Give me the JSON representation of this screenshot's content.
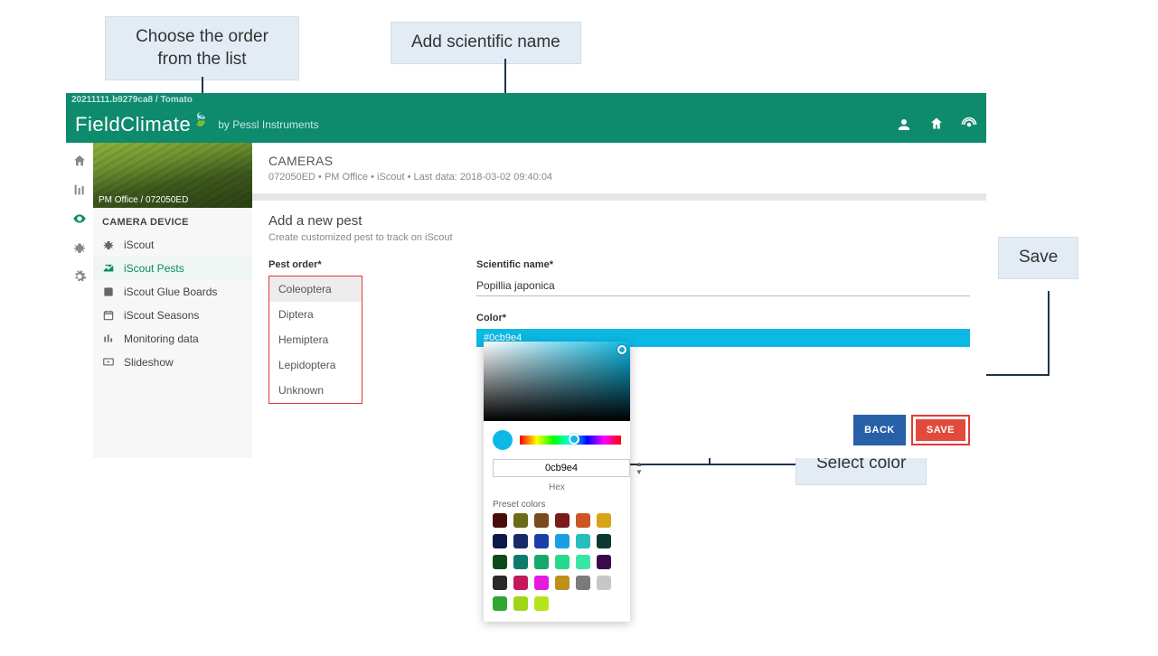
{
  "callouts": {
    "order": "Choose the order\nfrom the list",
    "sciname": "Add scientific name",
    "selcolor": "Select color",
    "save": "Save"
  },
  "breadcrumb": "20211111.b9279ca8 / Tomato",
  "logo_main": "FieldClimate",
  "logo_sub": "by Pessl Instruments",
  "sidebar": {
    "img_caption": "PM Office / 072050ED",
    "heading": "CAMERA DEVICE",
    "items": [
      {
        "label": "iScout"
      },
      {
        "label": "iScout Pests"
      },
      {
        "label": "iScout Glue Boards"
      },
      {
        "label": "iScout Seasons"
      },
      {
        "label": "Monitoring data"
      },
      {
        "label": "Slideshow"
      }
    ]
  },
  "panel": {
    "title": "CAMERAS",
    "sub": "072050ED • PM Office • iScout • Last data: 2018-03-02 09:40:04"
  },
  "form": {
    "title": "Add a new pest",
    "desc": "Create customized pest to track on iScout",
    "order_label": "Pest order*",
    "order_options": [
      "Coleoptera",
      "Diptera",
      "Hemiptera",
      "Lepidoptera",
      "Unknown"
    ],
    "sci_label": "Scientific name*",
    "sci_value": "Popillia japonica",
    "color_label": "Color*",
    "color_value": "#0cb9e4",
    "back": "BACK",
    "save": "SAVE"
  },
  "colorpicker": {
    "hex_value": "0cb9e4",
    "hex_label": "Hex",
    "preset_label": "Preset colors",
    "presets": [
      "#4a0b0b",
      "#6b6b1a",
      "#7a4a1a",
      "#7a1a1a",
      "#cc5522",
      "#d9a318",
      "#0b1a4a",
      "#152a66",
      "#1a3fa6",
      "#1a9fe6",
      "#26bdbd",
      "#0b3a33",
      "#0b4a1a",
      "#0e7a6b",
      "#18a86b",
      "#26d98c",
      "#3ae6a6",
      "#3a0b4a",
      "#2a2a2a",
      "#c21a5b",
      "#e61adf",
      "#bf8f1a",
      "#7a7a7a",
      "#c7c7c7",
      "#2fa62f",
      "#9fd61a",
      "#b3e61a"
    ]
  }
}
